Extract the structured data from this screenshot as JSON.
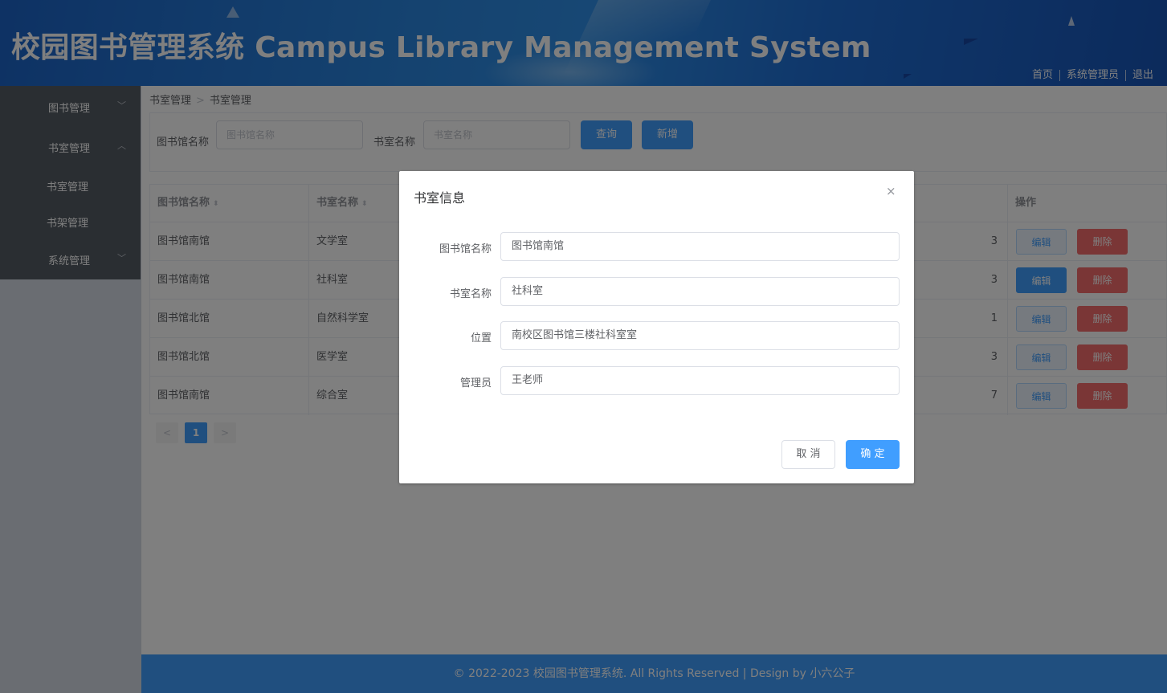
{
  "header": {
    "title": "校园图书管理系统 Campus Library Management System",
    "links": [
      "首页",
      "系统管理员",
      "退出"
    ]
  },
  "sidebar": {
    "menu": [
      {
        "label": "图书管理",
        "chevron": "﹀"
      },
      {
        "label": "书室管理",
        "chevron": "︿"
      },
      {
        "label": "系统管理",
        "chevron": "﹀"
      }
    ],
    "submenu": [
      {
        "label": "书室管理"
      },
      {
        "label": "书架管理"
      }
    ]
  },
  "breadcrumb": {
    "first": "书室管理",
    "separator": ">",
    "second": "书室管理"
  },
  "search": {
    "library_label": "图书馆名称",
    "library_placeholder": "图书馆名称",
    "room_label": "书室名称",
    "room_placeholder": "书室名称",
    "query_button": "查询",
    "add_button": "新增"
  },
  "table": {
    "headers": [
      "图书馆名称",
      "书室名称",
      "操作"
    ],
    "sort_icon": "⬍",
    "rows": [
      {
        "library": "图书馆南馆",
        "room": "文学室",
        "tail": "3"
      },
      {
        "library": "图书馆南馆",
        "room": "社科室",
        "tail": "3"
      },
      {
        "library": "图书馆北馆",
        "room": "自然科学室",
        "tail": "1"
      },
      {
        "library": "图书馆北馆",
        "room": "医学室",
        "tail": "3"
      },
      {
        "library": "图书馆南馆",
        "room": "综合室",
        "tail": "7"
      }
    ],
    "edit_label": "编辑",
    "delete_label": "删除"
  },
  "pagination": {
    "prev": "<",
    "current": "1",
    "next": ">"
  },
  "footer": {
    "text": "© 2022-2023 校园图书管理系统. All Rights Reserved | Design by 小六公子"
  },
  "dialog": {
    "title": "书室信息",
    "close": "×",
    "fields": [
      {
        "label": "图书馆名称",
        "value": "图书馆南馆"
      },
      {
        "label": "书室名称",
        "value": "社科室"
      },
      {
        "label": "位置",
        "value": "南校区图书馆三楼社科室室"
      },
      {
        "label": "管理员",
        "value": "王老师"
      }
    ],
    "cancel": "取 消",
    "confirm": "确 定"
  },
  "colors": {
    "primary": "#409eff",
    "danger": "#f56c6c",
    "sidebar": "#545c64"
  }
}
